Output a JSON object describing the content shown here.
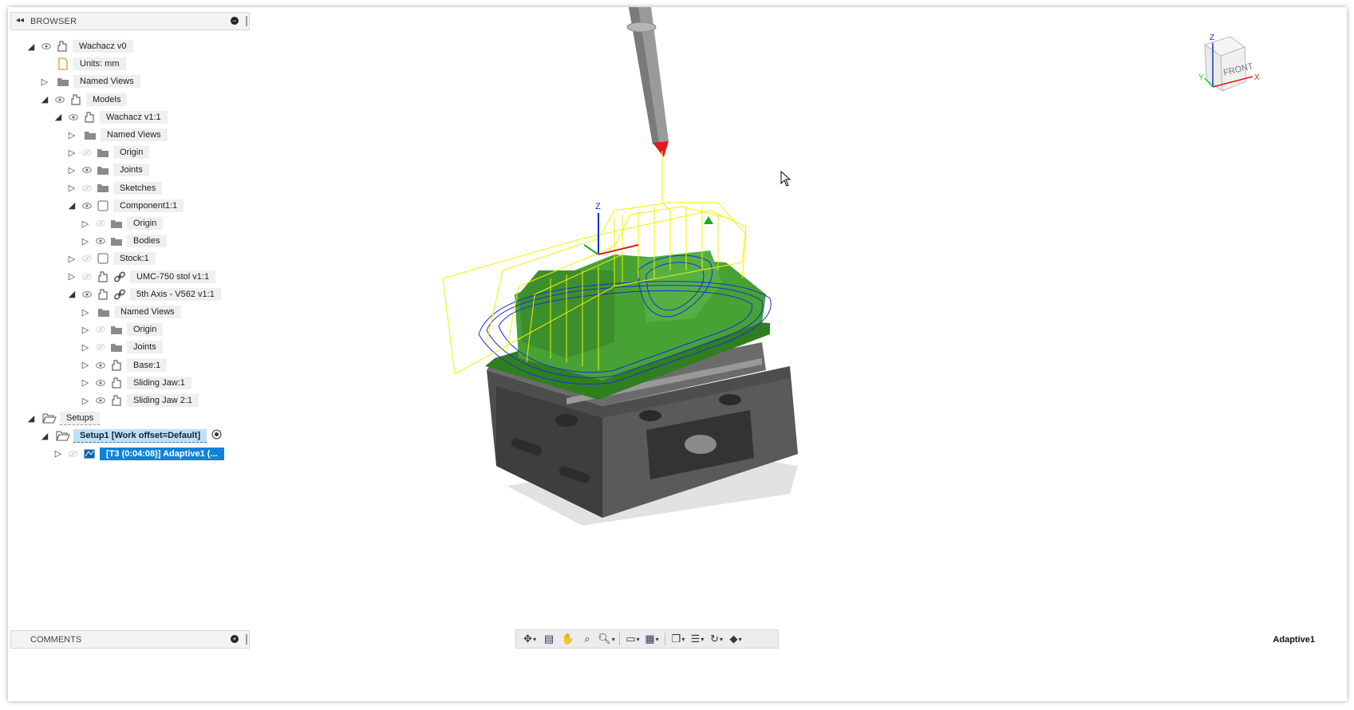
{
  "browser": {
    "title": "BROWSER",
    "collapse_icon": "double-chevron-left-icon",
    "tree": [
      {
        "label": "Wachacz v0",
        "depth": 0,
        "state": "open",
        "eye": "visible",
        "icon": "component-icon"
      },
      {
        "label": "Units: mm",
        "depth": 1,
        "state": "none",
        "eye": "none",
        "icon": "document-icon"
      },
      {
        "label": "Named Views",
        "depth": 1,
        "state": "closed",
        "eye": "none",
        "icon": "folder-icon"
      },
      {
        "label": "Models",
        "depth": 1,
        "state": "open",
        "eye": "visible",
        "icon": "component-icon"
      },
      {
        "label": "Wachacz v1:1",
        "depth": 2,
        "state": "open",
        "eye": "visible",
        "icon": "component-icon"
      },
      {
        "label": "Named Views",
        "depth": 3,
        "state": "closed",
        "eye": "none",
        "icon": "folder-icon"
      },
      {
        "label": "Origin",
        "depth": 3,
        "state": "closed",
        "eye": "hidden",
        "icon": "folder-icon"
      },
      {
        "label": "Joints",
        "depth": 3,
        "state": "closed",
        "eye": "visible",
        "icon": "folder-icon"
      },
      {
        "label": "Sketches",
        "depth": 3,
        "state": "closed",
        "eye": "hidden",
        "icon": "folder-icon"
      },
      {
        "label": "Component1:1",
        "depth": 3,
        "state": "open",
        "eye": "visible",
        "icon": "body-icon"
      },
      {
        "label": "Origin",
        "depth": 4,
        "state": "closed",
        "eye": "hidden",
        "icon": "folder-icon"
      },
      {
        "label": "Bodies",
        "depth": 4,
        "state": "closed",
        "eye": "visible",
        "icon": "folder-icon"
      },
      {
        "label": "Stock:1",
        "depth": 3,
        "state": "closed",
        "eye": "hidden",
        "icon": "body-icon"
      },
      {
        "label": "UMC-750 stol v1:1",
        "depth": 3,
        "state": "closed",
        "eye": "hidden",
        "icon": "component-icon",
        "link": true
      },
      {
        "label": "5th Axis - V562 v1:1",
        "depth": 3,
        "state": "open",
        "eye": "visible",
        "icon": "component-icon",
        "link": true
      },
      {
        "label": "Named Views",
        "depth": 4,
        "state": "closed",
        "eye": "none",
        "icon": "folder-icon"
      },
      {
        "label": "Origin",
        "depth": 4,
        "state": "closed",
        "eye": "hidden",
        "icon": "folder-icon"
      },
      {
        "label": "Joints",
        "depth": 4,
        "state": "closed",
        "eye": "hidden-light",
        "icon": "folder-icon"
      },
      {
        "label": "Base:1",
        "depth": 4,
        "state": "closed",
        "eye": "visible",
        "icon": "component-icon"
      },
      {
        "label": "Sliding Jaw:1",
        "depth": 4,
        "state": "closed",
        "eye": "visible",
        "icon": "component-icon"
      },
      {
        "label": "Sliding Jaw 2:1",
        "depth": 4,
        "state": "closed",
        "eye": "visible",
        "icon": "component-icon"
      },
      {
        "label": "Setups",
        "depth": 0,
        "state": "open",
        "eye": "none",
        "icon": "open-folder-icon",
        "style": "dashed"
      },
      {
        "label": "Setup1 [Work offset=Default]",
        "depth": 1,
        "state": "open",
        "eye": "none",
        "icon": "open-folder-icon",
        "style": "sel1",
        "radio": true
      },
      {
        "label": "[T3 (0:04:08)] Adaptive1 (...",
        "depth": 2,
        "state": "closed",
        "eye": "hidden",
        "icon": "toolpath-icon",
        "style": "sel2"
      }
    ]
  },
  "comments": {
    "title": "COMMENTS"
  },
  "toolbar": {
    "items": [
      "orbit-icon",
      "look-at-icon",
      "pan-icon",
      "zoom-window-icon",
      "zoom-icon",
      "display-mode-icon",
      "grid-icon",
      "visual-style-icon",
      "section-icon",
      "simulate-icon",
      "view-cube-icon"
    ]
  },
  "viewcube": {
    "face": "FRONT",
    "axis_z": "Z",
    "axis_x": "X",
    "axis_y": "Y"
  },
  "viewport": {
    "axis_label": "Z"
  },
  "status": {
    "operation": "Adaptive1"
  },
  "colors": {
    "toolpath_yellow": "#f2f000",
    "toolpath_blue": "#1a2fd6",
    "part_green": "#3f9a2c",
    "vise_dark": "#5b5b5b",
    "selection": "#0e83d8"
  }
}
